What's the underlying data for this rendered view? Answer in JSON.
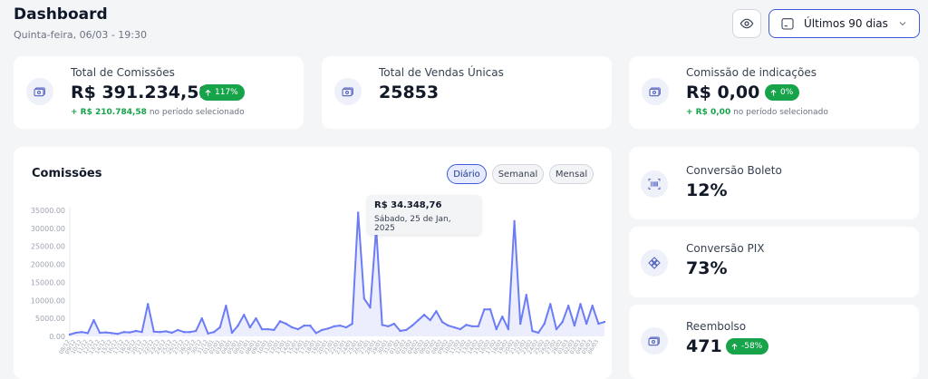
{
  "header": {
    "title": "Dashboard",
    "subtitle": "Quinta-feira, 06/03 - 19:30",
    "date_range": "Últimos 90 dias"
  },
  "cards": {
    "comissoes": {
      "label": "Total de Comissões",
      "value": "R$ 391.234,59",
      "badge": "117%",
      "delta": "+ R$ 210.784,58",
      "note": "no período selecionado",
      "icon": "money-icon"
    },
    "vendas": {
      "label": "Total de Vendas Únicas",
      "value": "25853",
      "icon": "money-icon"
    },
    "indicacoes": {
      "label": "Comissão de indicações",
      "value": "R$ 0,00",
      "badge": "0%",
      "delta": "+ R$ 0,00",
      "note": "no período selecionado",
      "icon": "money-icon"
    },
    "boleto": {
      "label": "Conversão Boleto",
      "value": "12%",
      "icon": "barcode-icon"
    },
    "pix": {
      "label": "Conversão PIX",
      "value": "73%",
      "icon": "pix-icon"
    },
    "reembolso": {
      "label": "Reembolso",
      "value": "471",
      "badge": "-58%",
      "icon": "money-icon"
    }
  },
  "chart": {
    "title": "Comissões",
    "tabs": [
      "Diário",
      "Semanal",
      "Mensal"
    ],
    "active_tab": "Diário",
    "tooltip": {
      "value": "R$ 34.348,76",
      "date": "Sábado, 25 de Jan, 2025"
    },
    "line_color": "#6b7cf5",
    "fill_color": "#eceefd"
  },
  "chart_data": {
    "type": "area",
    "title": "Comissões",
    "xlabel": "",
    "ylabel": "",
    "ylim": [
      0,
      35000
    ],
    "yticks": [
      "0.00",
      "5000.00",
      "10000.00",
      "15000.00",
      "20000.00",
      "25000.00",
      "30000.00",
      "35000.00"
    ],
    "grid": false,
    "x": [
      "08/12",
      "09/12",
      "10/12",
      "11/12",
      "12/12",
      "13/12",
      "14/12",
      "15/12",
      "16/12",
      "17/12",
      "18/12",
      "19/12",
      "20/12",
      "21/12",
      "22/12",
      "23/12",
      "24/12",
      "25/12",
      "26/12",
      "27/12",
      "28/12",
      "29/12",
      "30/12",
      "31/12",
      "01/01",
      "02/01",
      "03/01",
      "04/01",
      "05/01",
      "06/01",
      "07/01",
      "08/01",
      "09/01",
      "10/01",
      "11/01",
      "12/01",
      "13/01",
      "14/01",
      "15/01",
      "16/01",
      "17/01",
      "18/01",
      "19/01",
      "20/01",
      "21/01",
      "22/01",
      "23/01",
      "24/01",
      "25/01",
      "26/01",
      "27/01",
      "28/01",
      "29/01",
      "30/01",
      "31/01",
      "01/02",
      "02/02",
      "03/02",
      "04/02",
      "05/02",
      "06/02",
      "07/02",
      "08/02",
      "09/02",
      "10/02",
      "11/02",
      "12/02",
      "13/02",
      "14/02",
      "15/02",
      "16/02",
      "17/02",
      "18/02",
      "19/02",
      "20/02",
      "21/02",
      "22/02",
      "23/02",
      "24/02",
      "25/02",
      "26/02",
      "27/02",
      "28/02",
      "01/03",
      "02/03",
      "03/03",
      "04/03",
      "05/03",
      "06/03"
    ],
    "series": [
      {
        "values": [
          500,
          1000,
          1200,
          900,
          4500,
          1000,
          1100,
          900,
          700,
          1200,
          1100,
          1500,
          1200,
          9000,
          1300,
          1200,
          1400,
          1000,
          1800,
          1200,
          1200,
          1500,
          5000,
          800,
          1200,
          2500,
          8500,
          1000,
          3000,
          6000,
          2500,
          5000,
          2000,
          2000,
          1800,
          4200,
          3500,
          2500,
          2000,
          3000,
          3000,
          900,
          1800,
          2200,
          2800,
          3000,
          2500,
          3500,
          34348,
          10500,
          8000,
          30000,
          3200,
          2800,
          3500,
          1500,
          1800,
          3000,
          4500,
          6000,
          4500,
          7000,
          4000,
          3000,
          2500,
          2000,
          3200,
          2800,
          2800,
          7500,
          7500,
          2000,
          5500,
          2000,
          32000,
          3500,
          11500,
          1500,
          1000,
          3500,
          9000,
          2000,
          4000,
          8500,
          3000,
          9000,
          3500,
          8500,
          3500,
          4000
        ]
      }
    ]
  }
}
